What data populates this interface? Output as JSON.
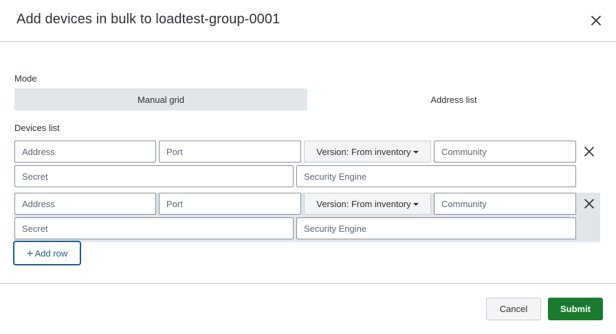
{
  "dialog": {
    "title": "Add devices in bulk to loadtest-group-0001",
    "close_icon": "close-icon"
  },
  "mode": {
    "label": "Mode",
    "options": [
      "Manual grid",
      "Address list"
    ],
    "selected": "Manual grid"
  },
  "devices": {
    "label": "Devices list",
    "rows": [
      {
        "address_placeholder": "Address",
        "port_placeholder": "Port",
        "version_label": "Version: From inventory",
        "community_placeholder": "Community",
        "secret_placeholder": "Secret",
        "security_engine_placeholder": "Security Engine"
      },
      {
        "address_placeholder": "Address",
        "port_placeholder": "Port",
        "version_label": "Version: From inventory",
        "community_placeholder": "Community",
        "secret_placeholder": "Secret",
        "security_engine_placeholder": "Security Engine"
      }
    ],
    "add_row_label": "Add row"
  },
  "footer": {
    "cancel_label": "Cancel",
    "submit_label": "Submit"
  },
  "colors": {
    "submit": "#1a7a2e",
    "add_row_border": "#1a5c8a",
    "toggle_active": "#e1e6eb"
  }
}
